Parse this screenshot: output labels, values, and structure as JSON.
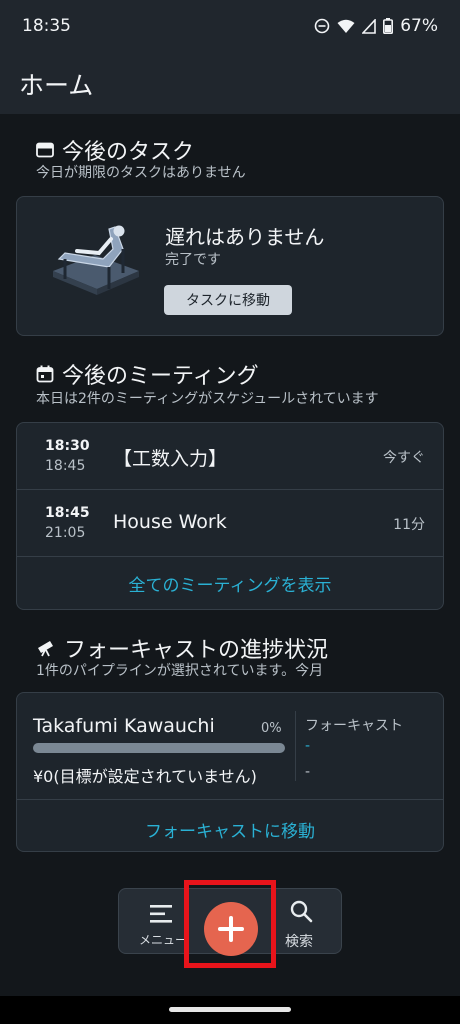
{
  "status": {
    "time": "18:35",
    "battery": "67%",
    "icons": [
      "do-not-disturb-icon",
      "wifi-icon",
      "cell-signal-icon",
      "battery-icon"
    ]
  },
  "header": {
    "title": "ホーム"
  },
  "tasks": {
    "title": "今後のタスク",
    "subtitle": "今日が期限のタスクはありません",
    "card_title": "遅れはありません",
    "card_sub": "完了です",
    "button": "タスクに移動"
  },
  "meetings": {
    "title": "今後のミーティング",
    "subtitle": "本日は2件のミーティングがスケジュールされています",
    "items": [
      {
        "start": "18:30",
        "end": "18:45",
        "title": "【工数入力】",
        "when": "今すぐ"
      },
      {
        "start": "18:45",
        "end": "21:05",
        "title": "House Work",
        "when": "11分"
      }
    ],
    "show_all": "全てのミーティングを表示"
  },
  "forecast": {
    "title": "フォーキャストの進捗状況",
    "subtitle": "1件のパイプラインが選択されています。今月",
    "name": "Takafumi Kawauchi",
    "percent": "0%",
    "progress": 0,
    "amount": "¥0(目標が設定されていません)",
    "label": "フォーキャスト",
    "value1": "-",
    "value2": "-",
    "link": "フォーキャストに移動"
  },
  "dock": {
    "menu": "メニュー",
    "search": "検索"
  },
  "colors": {
    "accent": "#2ab1d4",
    "fab": "#e5654f",
    "highlight": "#e8141b"
  }
}
